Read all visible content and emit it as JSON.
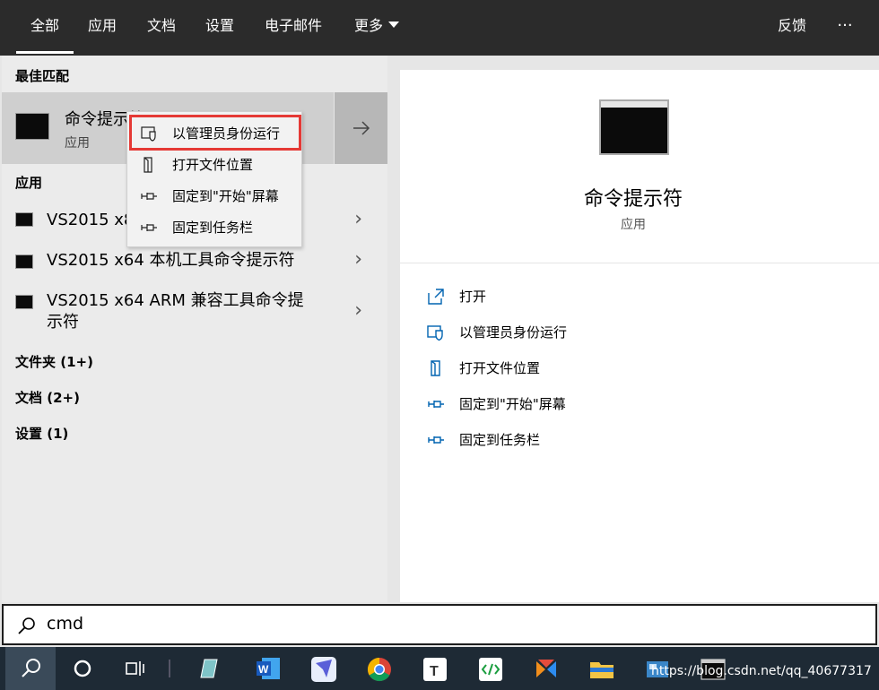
{
  "tabs": [
    {
      "label": "全部"
    },
    {
      "label": "应用"
    },
    {
      "label": "文档"
    },
    {
      "label": "设置"
    },
    {
      "label": "电子邮件"
    },
    {
      "label": "更多"
    }
  ],
  "feedback_label": "反馈",
  "more_options_label": "···",
  "left": {
    "best_match_heading": "最佳匹配",
    "best_match": {
      "name": "命令提示符",
      "type": "应用"
    },
    "apps_heading": "应用",
    "apps": [
      {
        "label": "VS2015 x86 本机工具命令提示符"
      },
      {
        "label": "VS2015 x64 本机工具命令提示符"
      },
      {
        "label": "VS2015 x64 ARM 兼容工具命令提示符"
      }
    ],
    "categories": [
      {
        "label": "文件夹 (1+)"
      },
      {
        "label": "文档 (2+)"
      },
      {
        "label": "设置 (1)"
      }
    ]
  },
  "context_menu": {
    "items": [
      {
        "label": "以管理员身份运行",
        "icon": "shield-icon"
      },
      {
        "label": "打开文件位置",
        "icon": "file-icon"
      },
      {
        "label": "固定到\"开始\"屏幕",
        "icon": "pin-icon"
      },
      {
        "label": "固定到任务栏",
        "icon": "pin-icon"
      }
    ],
    "highlight_color": "#e53935"
  },
  "preview": {
    "title": "命令提示符",
    "subtitle": "应用",
    "actions": [
      {
        "label": "打开",
        "icon": "open-icon"
      },
      {
        "label": "以管理员身份运行",
        "icon": "shield-icon"
      },
      {
        "label": "打开文件位置",
        "icon": "file-icon"
      },
      {
        "label": "固定到\"开始\"屏幕",
        "icon": "pin-icon"
      },
      {
        "label": "固定到任务栏",
        "icon": "pin-icon"
      }
    ],
    "accent_color": "#0063b1"
  },
  "search": {
    "value": "cmd",
    "icon": "search-icon"
  },
  "taskbar": {
    "items": [
      {
        "icon": "search-icon"
      },
      {
        "icon": "cortana-icon"
      },
      {
        "icon": "task-view-icon"
      },
      {
        "icon": "notepad-app-icon"
      },
      {
        "icon": "word-icon"
      },
      {
        "icon": "app-icon"
      },
      {
        "icon": "chrome-icon"
      },
      {
        "icon": "typora-icon"
      },
      {
        "icon": "code-editor-icon"
      },
      {
        "icon": "xmind-icon"
      },
      {
        "icon": "file-explorer-icon"
      },
      {
        "icon": "app-icon"
      },
      {
        "icon": "terminal-icon"
      }
    ],
    "watermark": "https://blog.csdn.net/qq_40677317"
  }
}
